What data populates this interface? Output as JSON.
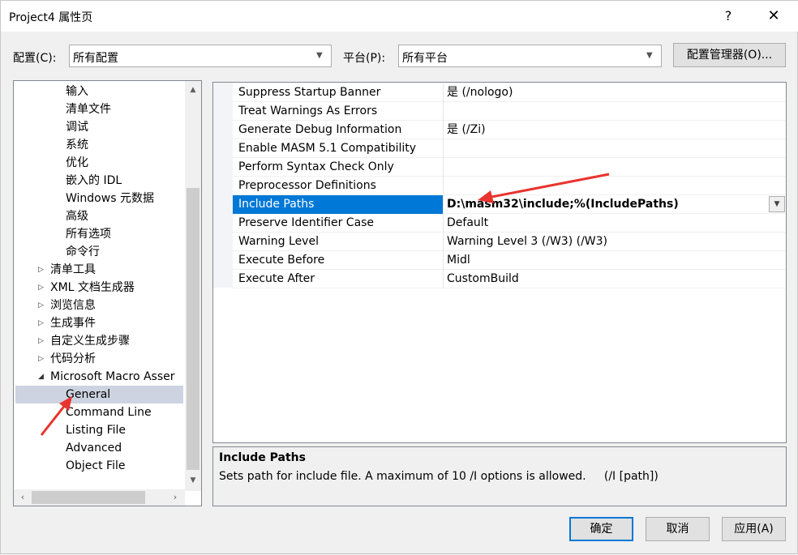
{
  "window": {
    "title": "Project4 属性页",
    "help": "?",
    "close": "✕"
  },
  "config": {
    "label": "配置(C):",
    "value": "所有配置"
  },
  "platform": {
    "label": "平台(P):",
    "value": "所有平台"
  },
  "config_manager_label": "配置管理器(O)...",
  "tree": {
    "items": [
      {
        "label": "输入",
        "indent": 2,
        "expander": ""
      },
      {
        "label": "清单文件",
        "indent": 2,
        "expander": ""
      },
      {
        "label": "调试",
        "indent": 2,
        "expander": ""
      },
      {
        "label": "系统",
        "indent": 2,
        "expander": ""
      },
      {
        "label": "优化",
        "indent": 2,
        "expander": ""
      },
      {
        "label": "嵌入的 IDL",
        "indent": 2,
        "expander": ""
      },
      {
        "label": "Windows 元数据",
        "indent": 2,
        "expander": ""
      },
      {
        "label": "高级",
        "indent": 2,
        "expander": ""
      },
      {
        "label": "所有选项",
        "indent": 2,
        "expander": ""
      },
      {
        "label": "命令行",
        "indent": 2,
        "expander": ""
      },
      {
        "label": "清单工具",
        "indent": 1,
        "expander": "▷"
      },
      {
        "label": "XML 文档生成器",
        "indent": 1,
        "expander": "▷"
      },
      {
        "label": "浏览信息",
        "indent": 1,
        "expander": "▷"
      },
      {
        "label": "生成事件",
        "indent": 1,
        "expander": "▷"
      },
      {
        "label": "自定义生成步骤",
        "indent": 1,
        "expander": "▷"
      },
      {
        "label": "代码分析",
        "indent": 1,
        "expander": "▷"
      },
      {
        "label": "Microsoft Macro Asser",
        "indent": 1,
        "expander": "◢"
      },
      {
        "label": "General",
        "indent": 2,
        "expander": ""
      },
      {
        "label": "Command Line",
        "indent": 2,
        "expander": ""
      },
      {
        "label": "Listing File",
        "indent": 2,
        "expander": ""
      },
      {
        "label": "Advanced",
        "indent": 2,
        "expander": ""
      },
      {
        "label": "Object File",
        "indent": 2,
        "expander": ""
      }
    ],
    "selected_index": 17
  },
  "grid": {
    "rows": [
      {
        "name": "Suppress Startup Banner",
        "value": "是 (/nologo)"
      },
      {
        "name": "Treat Warnings As Errors",
        "value": ""
      },
      {
        "name": "Generate Debug Information",
        "value": "是 (/Zi)"
      },
      {
        "name": "Enable MASM 5.1 Compatibility",
        "value": ""
      },
      {
        "name": "Perform Syntax Check Only",
        "value": ""
      },
      {
        "name": "Preprocessor Definitions",
        "value": ""
      },
      {
        "name": "Include Paths",
        "value": "D:\\masm32\\include;%(IncludePaths)"
      },
      {
        "name": "Preserve Identifier Case",
        "value": "Default"
      },
      {
        "name": "Warning Level",
        "value": "Warning Level 3 (/W3) (/W3)"
      },
      {
        "name": "Execute Before",
        "value": "Midl"
      },
      {
        "name": "Execute After",
        "value": "CustomBuild"
      }
    ],
    "selected_index": 6
  },
  "description": {
    "title": "Include Paths",
    "text": "Sets path for include file. A maximum of 10 /I options is allowed.     (/I [path])"
  },
  "buttons": {
    "ok": "确定",
    "cancel": "取消",
    "apply": "应用(A)"
  },
  "colors": {
    "selection": "#0078d7",
    "tree_selection": "#cdd3e0",
    "annotation_arrow": "#e8342f"
  }
}
